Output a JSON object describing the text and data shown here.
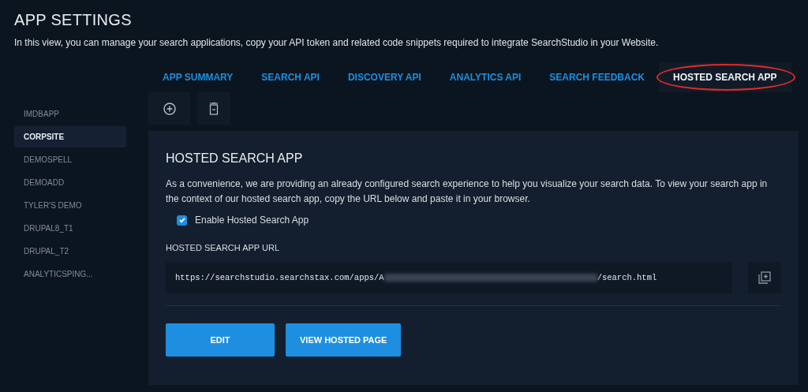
{
  "page": {
    "title": "APP SETTINGS",
    "description": "In this view, you can manage your search applications, copy your API token and related code snippets required to integrate SearchStudio in your Website."
  },
  "tabs": [
    {
      "label": "APP SUMMARY",
      "selected": false,
      "circled": false
    },
    {
      "label": "SEARCH API",
      "selected": false,
      "circled": false
    },
    {
      "label": "DISCOVERY API",
      "selected": false,
      "circled": false
    },
    {
      "label": "ANALYTICS API",
      "selected": false,
      "circled": false
    },
    {
      "label": "SEARCH FEEDBACK",
      "selected": false,
      "circled": false
    },
    {
      "label": "HOSTED SEARCH APP",
      "selected": true,
      "circled": true
    }
  ],
  "sidebar": {
    "items": [
      {
        "label": "IMDBAPP",
        "selected": false
      },
      {
        "label": "CORPSITE",
        "selected": true
      },
      {
        "label": "DEMOSPELL",
        "selected": false
      },
      {
        "label": "DEMOADD",
        "selected": false
      },
      {
        "label": "TYLER'S DEMO",
        "selected": false
      },
      {
        "label": "DRUPAL8_T1",
        "selected": false
      },
      {
        "label": "DRUPAL_T2",
        "selected": false
      },
      {
        "label": "ANALYTICSPING...",
        "selected": false
      }
    ]
  },
  "panel": {
    "title": "HOSTED SEARCH APP",
    "text": "As a convenience, we are providing an already configured search experience to help you visualize your search data. To view your search app in the context of our hosted search app, copy the URL below and paste it in your browser.",
    "checkbox": {
      "label": "Enable Hosted Search App",
      "checked": true
    },
    "url_label": "HOSTED SEARCH APP URL",
    "url_start": "https://searchstudio.searchstax.com/apps/A",
    "url_blurred": true,
    "url_end": "/search.html",
    "buttons": [
      "EDIT",
      "VIEW HOSTED PAGE"
    ]
  }
}
